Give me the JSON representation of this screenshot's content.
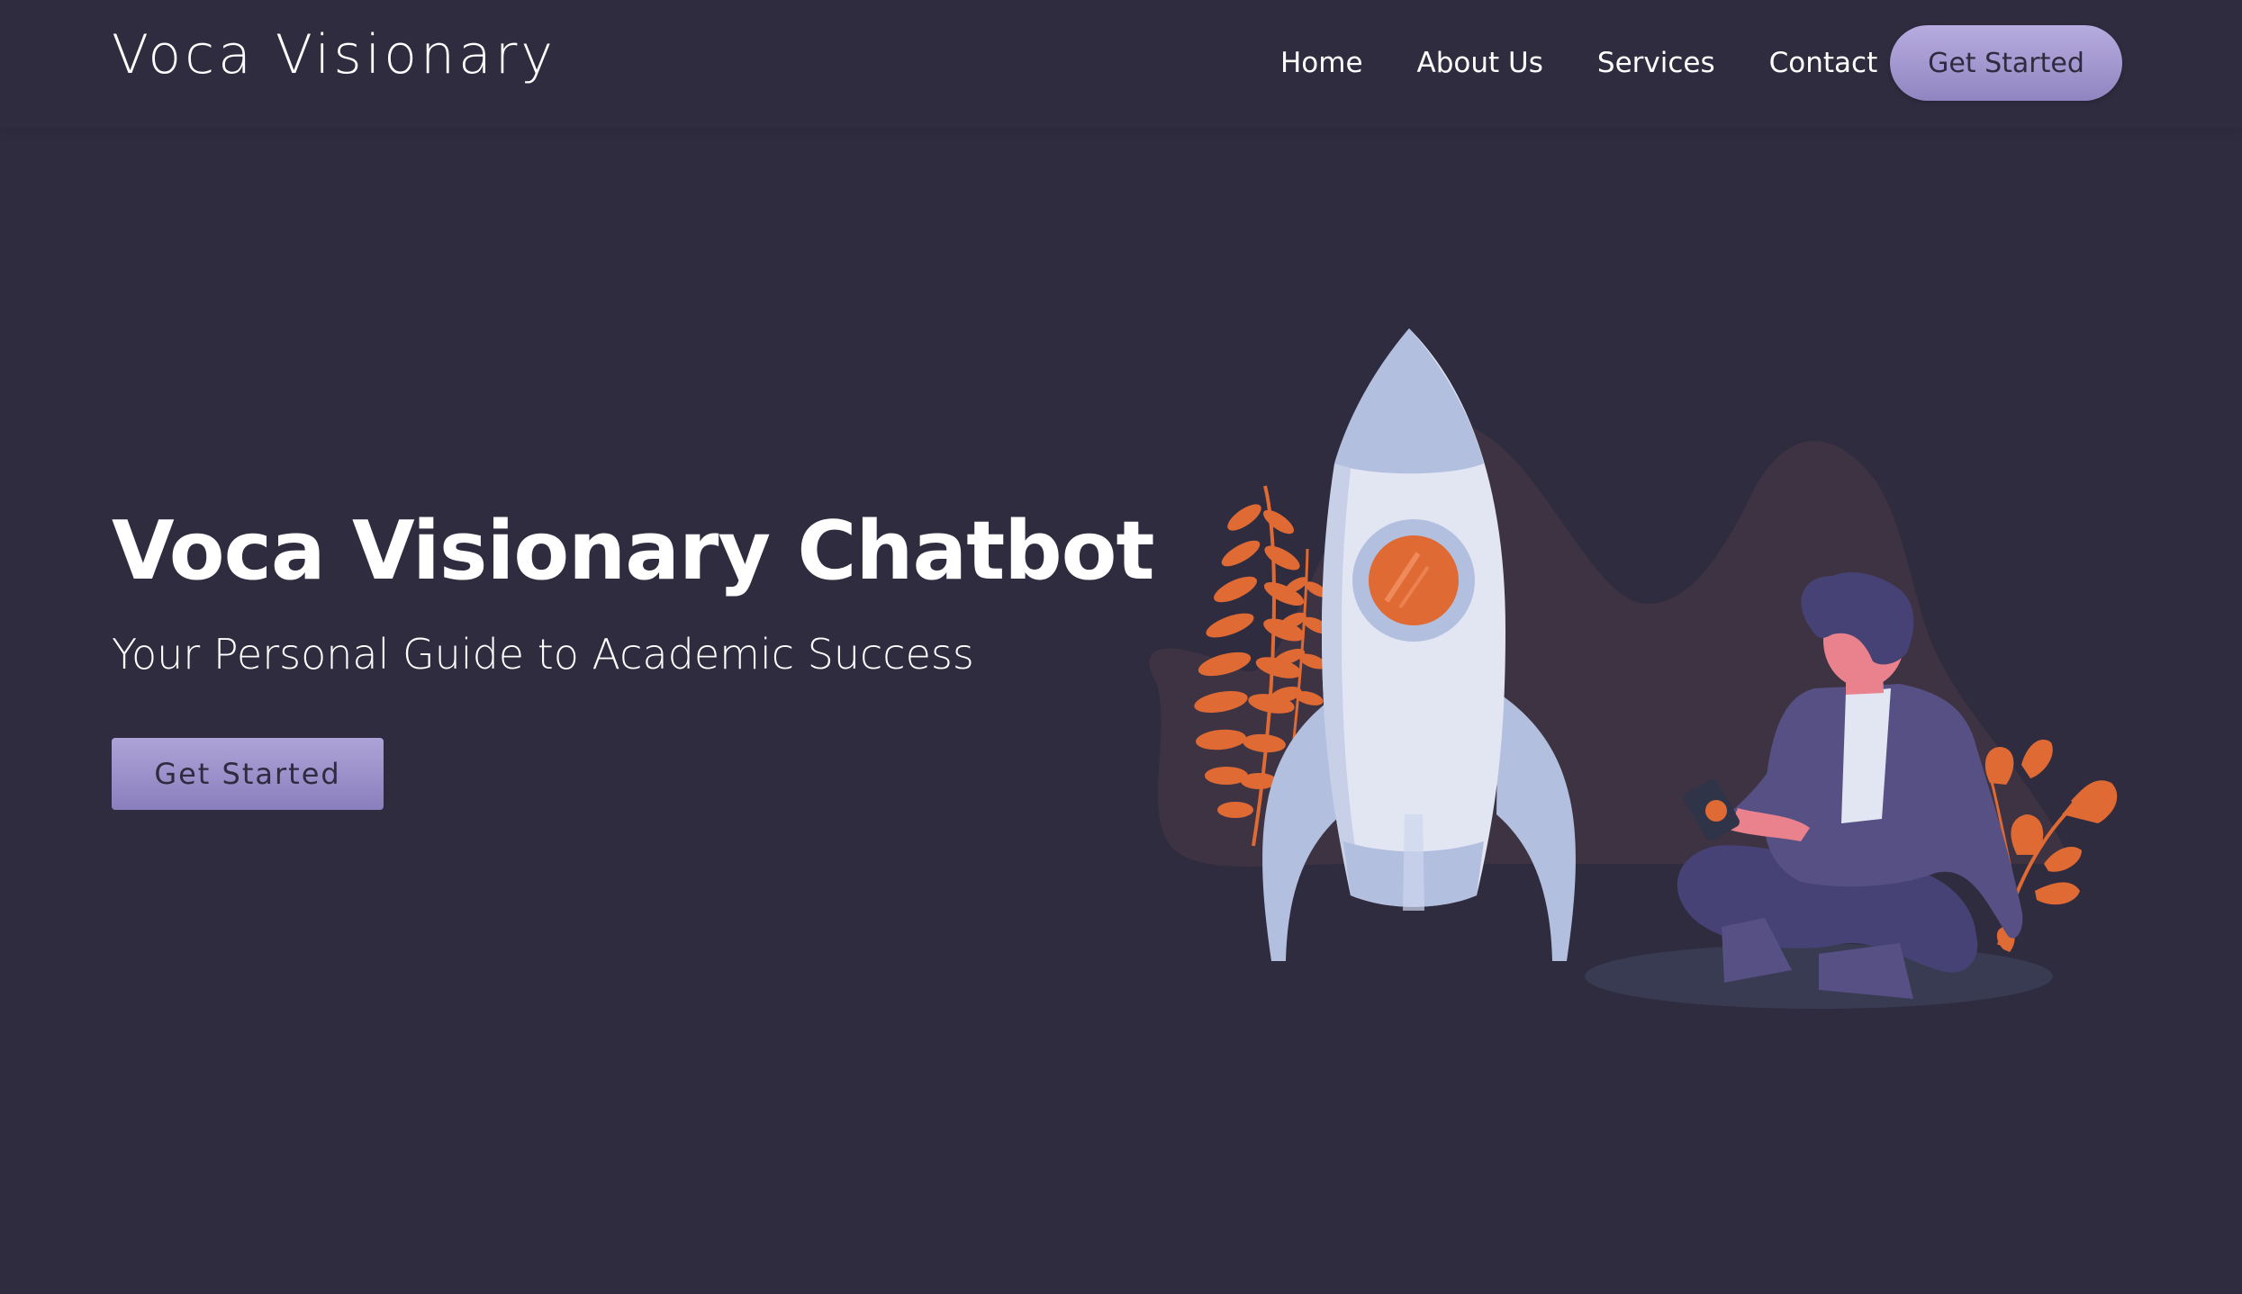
{
  "navbar": {
    "brand": "Voca Visionary",
    "links": [
      {
        "label": "Home"
      },
      {
        "label": "About Us"
      },
      {
        "label": "Services"
      },
      {
        "label": "Contact"
      }
    ],
    "cta_label": "Get Started"
  },
  "hero": {
    "title": "Voca Visionary Chatbot",
    "subtitle": "Your Personal Guide to Academic Success",
    "cta_label": "Get Started",
    "illustration": "rocket-launch-illustration"
  },
  "colors": {
    "background": "#2f2c40",
    "accent": "#9a8fcb",
    "orange": "#e06a33",
    "rocket": "#e2e6f3",
    "rocket_shade": "#b2bfdf",
    "hill": "#3d3342",
    "person": "#575085"
  }
}
